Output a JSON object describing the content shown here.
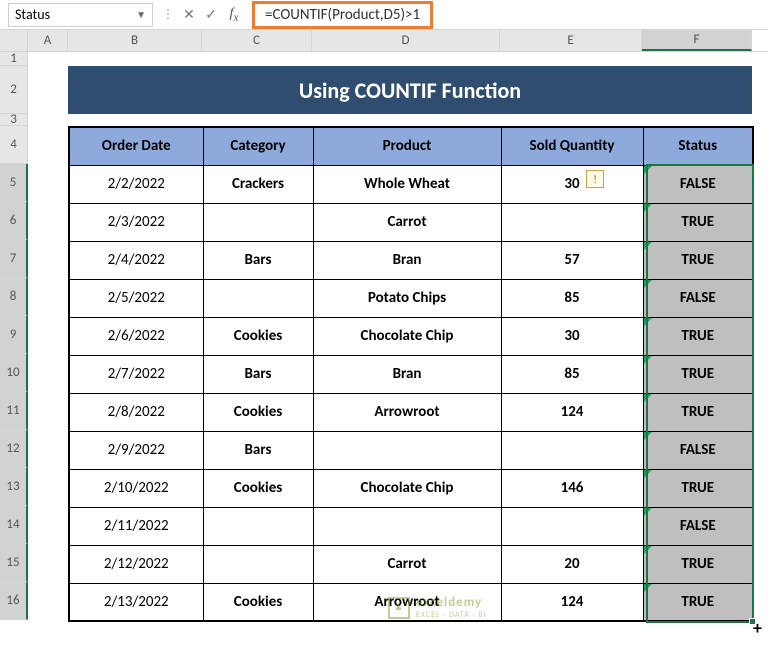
{
  "formula_bar": {
    "name_box": "Status",
    "formula": "=COUNTIF(Product,D5)>1"
  },
  "title": "Using COUNTIF Function",
  "columns": [
    "A",
    "B",
    "C",
    "D",
    "E",
    "F"
  ],
  "headers": {
    "order_date": "Order Date",
    "category": "Category",
    "product": "Product",
    "sold_quantity": "Sold Quantity",
    "status": "Status"
  },
  "rows": [
    {
      "date": "2/2/2022",
      "category": "Crackers",
      "product": "Whole Wheat",
      "qty": "30",
      "status": "FALSE"
    },
    {
      "date": "2/3/2022",
      "category": "",
      "product": "Carrot",
      "qty": "",
      "status": "TRUE"
    },
    {
      "date": "2/4/2022",
      "category": "Bars",
      "product": "Bran",
      "qty": "57",
      "status": "TRUE"
    },
    {
      "date": "2/5/2022",
      "category": "",
      "product": "Potato Chips",
      "qty": "85",
      "status": "FALSE"
    },
    {
      "date": "2/6/2022",
      "category": "Cookies",
      "product": "Chocolate Chip",
      "qty": "30",
      "status": "TRUE"
    },
    {
      "date": "2/7/2022",
      "category": "Bars",
      "product": "Bran",
      "qty": "85",
      "status": "TRUE"
    },
    {
      "date": "2/8/2022",
      "category": "Cookies",
      "product": "Arrowroot",
      "qty": "124",
      "status": "TRUE"
    },
    {
      "date": "2/9/2022",
      "category": "Bars",
      "product": "",
      "qty": "",
      "status": "FALSE"
    },
    {
      "date": "2/10/2022",
      "category": "Cookies",
      "product": "Chocolate Chip",
      "qty": "146",
      "status": "TRUE"
    },
    {
      "date": "2/11/2022",
      "category": "",
      "product": "",
      "qty": "",
      "status": "FALSE"
    },
    {
      "date": "2/12/2022",
      "category": "",
      "product": "Carrot",
      "qty": "20",
      "status": "TRUE"
    },
    {
      "date": "2/13/2022",
      "category": "Cookies",
      "product": "Arrowroot",
      "qty": "124",
      "status": "TRUE"
    }
  ],
  "row_numbers": [
    "1",
    "2",
    "3",
    "4",
    "5",
    "6",
    "7",
    "8",
    "9",
    "10",
    "11",
    "12",
    "13",
    "14",
    "15",
    "16"
  ],
  "watermark": {
    "brand": "exceldemy",
    "tagline": "EXCEL · DATA · BI"
  },
  "icons": {
    "warn": "!",
    "autofill": "▦"
  }
}
